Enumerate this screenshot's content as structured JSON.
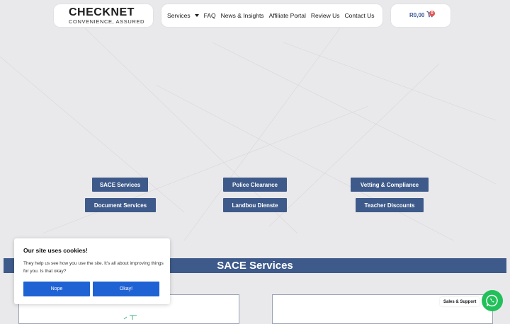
{
  "header": {
    "logo_text": "CHECKNET",
    "logo_tagline": "CONVENIENCE, ASSURED",
    "nav": [
      {
        "label": "Services"
      },
      {
        "label": "FAQ"
      },
      {
        "label": "News & Insights"
      },
      {
        "label": "Affiliate Portal"
      },
      {
        "label": "Review Us"
      },
      {
        "label": "Contact Us"
      }
    ],
    "cart_total": "R0,00",
    "cart_count": "0"
  },
  "service_buttons": [
    {
      "label": "SACE Services"
    },
    {
      "label": "Police Clearance"
    },
    {
      "label": "Vetting & Compliance"
    },
    {
      "label": "Document Services"
    },
    {
      "label": "Landbou Dienste"
    },
    {
      "label": "Teacher Discounts"
    }
  ],
  "section": {
    "title": "SACE Services"
  },
  "cookie": {
    "title": "Our site uses cookies!",
    "text": "They help us see how you use the site. It's all about improving things for you. Is that okay?",
    "nope_label": "Nope",
    "okay_label": "Okay!"
  },
  "whatsapp": {
    "label": "Sales & Support"
  },
  "colors": {
    "brand_blue": "#3e5a8a",
    "cookie_blue": "#1f62d4",
    "whatsapp_green": "#22c05a"
  }
}
